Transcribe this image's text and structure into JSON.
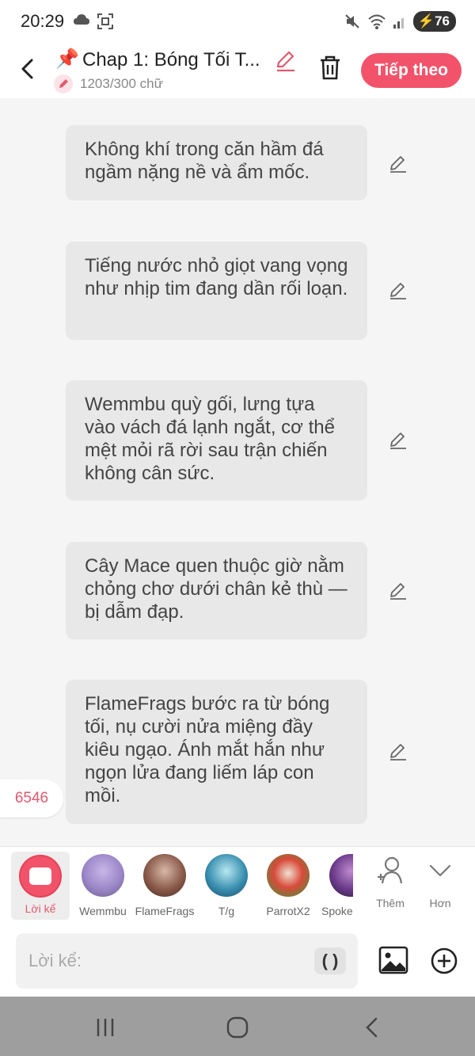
{
  "status_bar": {
    "time": "20:29",
    "battery": "76"
  },
  "header": {
    "title": "Chap 1: Bóng Tối T...",
    "word_count": "1203/300 chữ",
    "next_label": "Tiếp theo"
  },
  "messages": [
    {
      "text": "Không khí trong căn hầm đá ngầm nặng nề và ẩm mốc."
    },
    {
      "text": "Tiếng nước nhỏ giọt vang vọng như nhịp tim đang dần rối loạn."
    },
    {
      "text": "Wemmbu quỳ gối, lưng tựa vào vách đá lạnh ngắt, cơ thể mệt mỏi rã rời sau trận chiến không cân sức."
    },
    {
      "text": "Cây Mace quen thuộc giờ nằm chỏng chơ dưới chân kẻ thù — bị dẫm đạp."
    },
    {
      "text": "FlameFrags bước ra từ bóng tối, nụ cười nửa miệng đầy kiêu ngạo. Ánh mắt hắn như ngọn lửa đang liếm láp con mồi."
    }
  ],
  "count_badge": "6546",
  "characters": [
    {
      "name": "Lời kể",
      "icon": "narrator-icon",
      "color": "#f2536a"
    },
    {
      "name": "Wemmbu",
      "icon": "avatar",
      "color": "#9b87c8"
    },
    {
      "name": "FlameFrags",
      "icon": "avatar",
      "color": "#7a4a3a"
    },
    {
      "name": "T/g",
      "icon": "avatar",
      "color": "#3a8fb0"
    },
    {
      "name": "ParrotX2",
      "icon": "avatar",
      "color": "#d84a3a"
    },
    {
      "name": "Spoke",
      "icon": "avatar",
      "color": "#6a3a8a"
    }
  ],
  "more": {
    "add_label": "Thêm",
    "more_label": "Hơn"
  },
  "input": {
    "placeholder": "Lời kể:",
    "paren_label": "( )"
  }
}
